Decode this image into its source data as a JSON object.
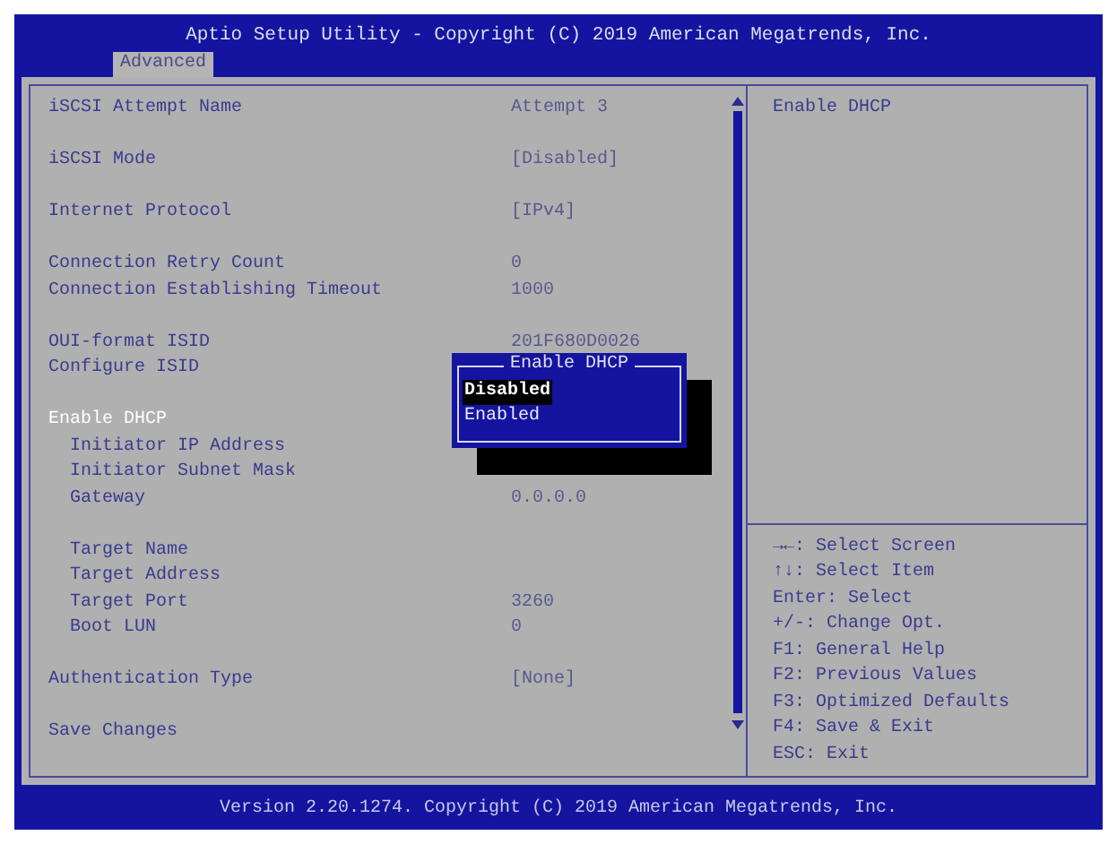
{
  "window": {
    "title": "Aptio Setup Utility - Copyright (C) 2019 American Megatrends, Inc."
  },
  "tabs": [
    {
      "label": "Advanced",
      "selected": true
    }
  ],
  "settings": [
    {
      "indented": false,
      "rows": [
        {
          "label": "iSCSI Attempt Name",
          "value": "Attempt 3",
          "selected": false
        }
      ]
    },
    {
      "indented": false,
      "rows": [
        {
          "label": "iSCSI Mode",
          "value": "[Disabled]",
          "selected": false
        }
      ]
    },
    {
      "indented": false,
      "rows": [
        {
          "label": "Internet Protocol",
          "value": "[IPv4]",
          "selected": false
        }
      ]
    },
    {
      "indented": false,
      "rows": [
        {
          "label": "Connection Retry Count",
          "value": "0",
          "selected": false
        },
        {
          "label": "Connection Establishing Timeout",
          "value": "1000",
          "selected": false
        }
      ]
    },
    {
      "indented": false,
      "rows": [
        {
          "label": "OUI-format ISID",
          "value": "201F680D0026",
          "selected": false
        },
        {
          "label": "Configure ISID",
          "selected": false
        }
      ]
    },
    {
      "indented": false,
      "rows": [
        {
          "label": "Enable DHCP",
          "selected": true,
          "children": [
            {
              "label": "Initiator IP Address",
              "selected": false
            },
            {
              "label": "Initiator Subnet Mask",
              "selected": false
            },
            {
              "label": "Gateway",
              "value": "0.0.0.0",
              "selected": false
            }
          ]
        }
      ]
    },
    {
      "indented": true,
      "rows": [
        {
          "label": "Target Name",
          "selected": false
        },
        {
          "label": "Target Address",
          "selected": false
        },
        {
          "label": "Target Port",
          "value": "3260",
          "selected": false
        },
        {
          "label": "Boot LUN",
          "value": "0",
          "selected": false
        }
      ]
    },
    {
      "indented": false,
      "rows": [
        {
          "label": "Authentication Type",
          "value": "[None]",
          "selected": false
        }
      ]
    },
    {
      "indented": false,
      "rows": [
        {
          "label": "Save Changes",
          "selected": false
        }
      ]
    }
  ],
  "popup": {
    "title": "Enable DHCP",
    "options": [
      {
        "label": "Disabled",
        "selected": true
      },
      {
        "label": "Enabled",
        "selected": false
      }
    ]
  },
  "help": {
    "text": "Enable DHCP",
    "keys": [
      "→←: Select Screen",
      "↑↓: Select Item",
      "Enter: Select",
      "+/-: Change Opt.",
      "F1: General Help",
      "F2: Previous Values",
      "F3: Optimized Defaults",
      "F4: Save & Exit",
      "ESC: Exit"
    ]
  },
  "status_bar": {
    "text": "Version 2.20.1274. Copyright (C) 2019 American Megatrends, Inc."
  }
}
